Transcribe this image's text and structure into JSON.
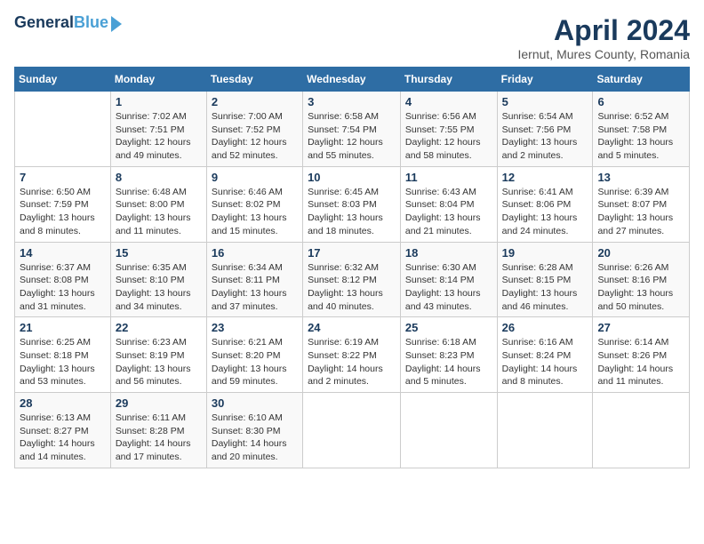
{
  "header": {
    "logo_line1": "General",
    "logo_line2": "Blue",
    "month_title": "April 2024",
    "subtitle": "Iernut, Mures County, Romania"
  },
  "days_of_week": [
    "Sunday",
    "Monday",
    "Tuesday",
    "Wednesday",
    "Thursday",
    "Friday",
    "Saturday"
  ],
  "weeks": [
    [
      {
        "day": "",
        "info": ""
      },
      {
        "day": "1",
        "info": "Sunrise: 7:02 AM\nSunset: 7:51 PM\nDaylight: 12 hours\nand 49 minutes."
      },
      {
        "day": "2",
        "info": "Sunrise: 7:00 AM\nSunset: 7:52 PM\nDaylight: 12 hours\nand 52 minutes."
      },
      {
        "day": "3",
        "info": "Sunrise: 6:58 AM\nSunset: 7:54 PM\nDaylight: 12 hours\nand 55 minutes."
      },
      {
        "day": "4",
        "info": "Sunrise: 6:56 AM\nSunset: 7:55 PM\nDaylight: 12 hours\nand 58 minutes."
      },
      {
        "day": "5",
        "info": "Sunrise: 6:54 AM\nSunset: 7:56 PM\nDaylight: 13 hours\nand 2 minutes."
      },
      {
        "day": "6",
        "info": "Sunrise: 6:52 AM\nSunset: 7:58 PM\nDaylight: 13 hours\nand 5 minutes."
      }
    ],
    [
      {
        "day": "7",
        "info": "Sunrise: 6:50 AM\nSunset: 7:59 PM\nDaylight: 13 hours\nand 8 minutes."
      },
      {
        "day": "8",
        "info": "Sunrise: 6:48 AM\nSunset: 8:00 PM\nDaylight: 13 hours\nand 11 minutes."
      },
      {
        "day": "9",
        "info": "Sunrise: 6:46 AM\nSunset: 8:02 PM\nDaylight: 13 hours\nand 15 minutes."
      },
      {
        "day": "10",
        "info": "Sunrise: 6:45 AM\nSunset: 8:03 PM\nDaylight: 13 hours\nand 18 minutes."
      },
      {
        "day": "11",
        "info": "Sunrise: 6:43 AM\nSunset: 8:04 PM\nDaylight: 13 hours\nand 21 minutes."
      },
      {
        "day": "12",
        "info": "Sunrise: 6:41 AM\nSunset: 8:06 PM\nDaylight: 13 hours\nand 24 minutes."
      },
      {
        "day": "13",
        "info": "Sunrise: 6:39 AM\nSunset: 8:07 PM\nDaylight: 13 hours\nand 27 minutes."
      }
    ],
    [
      {
        "day": "14",
        "info": "Sunrise: 6:37 AM\nSunset: 8:08 PM\nDaylight: 13 hours\nand 31 minutes."
      },
      {
        "day": "15",
        "info": "Sunrise: 6:35 AM\nSunset: 8:10 PM\nDaylight: 13 hours\nand 34 minutes."
      },
      {
        "day": "16",
        "info": "Sunrise: 6:34 AM\nSunset: 8:11 PM\nDaylight: 13 hours\nand 37 minutes."
      },
      {
        "day": "17",
        "info": "Sunrise: 6:32 AM\nSunset: 8:12 PM\nDaylight: 13 hours\nand 40 minutes."
      },
      {
        "day": "18",
        "info": "Sunrise: 6:30 AM\nSunset: 8:14 PM\nDaylight: 13 hours\nand 43 minutes."
      },
      {
        "day": "19",
        "info": "Sunrise: 6:28 AM\nSunset: 8:15 PM\nDaylight: 13 hours\nand 46 minutes."
      },
      {
        "day": "20",
        "info": "Sunrise: 6:26 AM\nSunset: 8:16 PM\nDaylight: 13 hours\nand 50 minutes."
      }
    ],
    [
      {
        "day": "21",
        "info": "Sunrise: 6:25 AM\nSunset: 8:18 PM\nDaylight: 13 hours\nand 53 minutes."
      },
      {
        "day": "22",
        "info": "Sunrise: 6:23 AM\nSunset: 8:19 PM\nDaylight: 13 hours\nand 56 minutes."
      },
      {
        "day": "23",
        "info": "Sunrise: 6:21 AM\nSunset: 8:20 PM\nDaylight: 13 hours\nand 59 minutes."
      },
      {
        "day": "24",
        "info": "Sunrise: 6:19 AM\nSunset: 8:22 PM\nDaylight: 14 hours\nand 2 minutes."
      },
      {
        "day": "25",
        "info": "Sunrise: 6:18 AM\nSunset: 8:23 PM\nDaylight: 14 hours\nand 5 minutes."
      },
      {
        "day": "26",
        "info": "Sunrise: 6:16 AM\nSunset: 8:24 PM\nDaylight: 14 hours\nand 8 minutes."
      },
      {
        "day": "27",
        "info": "Sunrise: 6:14 AM\nSunset: 8:26 PM\nDaylight: 14 hours\nand 11 minutes."
      }
    ],
    [
      {
        "day": "28",
        "info": "Sunrise: 6:13 AM\nSunset: 8:27 PM\nDaylight: 14 hours\nand 14 minutes."
      },
      {
        "day": "29",
        "info": "Sunrise: 6:11 AM\nSunset: 8:28 PM\nDaylight: 14 hours\nand 17 minutes."
      },
      {
        "day": "30",
        "info": "Sunrise: 6:10 AM\nSunset: 8:30 PM\nDaylight: 14 hours\nand 20 minutes."
      },
      {
        "day": "",
        "info": ""
      },
      {
        "day": "",
        "info": ""
      },
      {
        "day": "",
        "info": ""
      },
      {
        "day": "",
        "info": ""
      }
    ]
  ]
}
